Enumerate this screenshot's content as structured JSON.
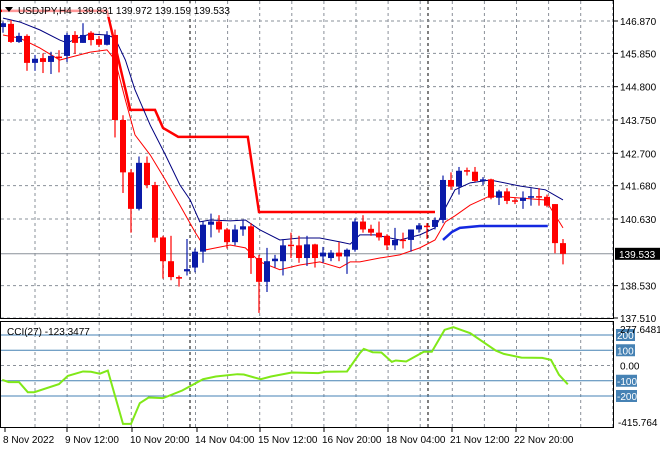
{
  "header": {
    "symbol": "USDJPY,H4",
    "ohlc": "139.831 139.972 139.159 139.533"
  },
  "indicator": {
    "label": "CCI(27) -123.3477"
  },
  "colors": {
    "bull": "#0a1aa8",
    "bear": "#ff0000",
    "upper_band": "#000080",
    "lower_band": "#ff0000",
    "step_red": "#ff0000",
    "step_blue": "#1428e0",
    "cci": "#80e818",
    "level": "#4682b4",
    "price_tag_bg": "#000000"
  },
  "price_axis": {
    "labels": [
      "146.870",
      "145.850",
      "144.800",
      "143.750",
      "142.700",
      "141.680",
      "140.630",
      "138.530",
      "137.510"
    ],
    "current_price": "139.533"
  },
  "cci_axis": {
    "max_label": "277.6481",
    "min_label": "-415.764",
    "zero_label": "0.00",
    "levels": [
      "200",
      "100",
      "-100",
      "-200"
    ]
  },
  "time_axis": {
    "labels": [
      "8 Nov 2022",
      "9 Nov 12:00",
      "10 Nov 20:00",
      "14 Nov 04:00",
      "15 Nov 12:00",
      "16 Nov 20:00",
      "18 Nov 04:00",
      "21 Nov 12:00",
      "22 Nov 20:00"
    ]
  },
  "chart_data": {
    "type": "candlestick",
    "title": "USDJPY,H4",
    "ylim": [
      137.51,
      146.87
    ],
    "candles_ohlc": [
      [
        146.68,
        146.85,
        146.5,
        146.8
      ],
      [
        146.78,
        146.9,
        146.18,
        146.21
      ],
      [
        146.21,
        146.5,
        146.18,
        146.4
      ],
      [
        146.4,
        146.45,
        145.3,
        145.55
      ],
      [
        145.55,
        145.8,
        145.3,
        145.68
      ],
      [
        145.7,
        145.85,
        145.23,
        145.58
      ],
      [
        145.58,
        145.9,
        145.2,
        145.77
      ],
      [
        145.75,
        145.95,
        145.25,
        145.7
      ],
      [
        145.77,
        146.5,
        145.58,
        146.43
      ],
      [
        146.43,
        146.55,
        145.83,
        146.18
      ],
      [
        146.18,
        146.8,
        146.18,
        146.43
      ],
      [
        146.5,
        146.55,
        146.1,
        146.27
      ],
      [
        146.3,
        146.4,
        146.05,
        146.12
      ],
      [
        146.12,
        146.55,
        146.1,
        146.43
      ],
      [
        146.43,
        146.6,
        143.2,
        143.75
      ],
      [
        143.75,
        143.9,
        141.45,
        142.1
      ],
      [
        142.1,
        142.2,
        140.2,
        140.95
      ],
      [
        140.95,
        142.6,
        140.9,
        142.4
      ],
      [
        142.4,
        142.6,
        141.6,
        141.7
      ],
      [
        141.7,
        141.8,
        139.9,
        140.04
      ],
      [
        140.05,
        140.1,
        138.75,
        139.3
      ],
      [
        139.3,
        140.1,
        138.7,
        138.8
      ],
      [
        138.8,
        138.85,
        138.5,
        138.75
      ],
      [
        138.98,
        140.0,
        138.85,
        139.05
      ],
      [
        139.1,
        139.7,
        138.95,
        139.6
      ],
      [
        139.6,
        140.55,
        139.25,
        140.45
      ],
      [
        140.45,
        140.8,
        140.05,
        140.55
      ],
      [
        140.55,
        140.75,
        140.2,
        140.3
      ],
      [
        140.3,
        140.35,
        139.7,
        139.9
      ],
      [
        139.9,
        140.45,
        139.8,
        140.3
      ],
      [
        140.3,
        140.6,
        140.1,
        140.4
      ],
      [
        140.4,
        140.5,
        138.9,
        139.4
      ],
      [
        139.4,
        139.5,
        137.67,
        138.65
      ],
      [
        138.65,
        139.72,
        138.33,
        139.3
      ],
      [
        139.3,
        139.5,
        139.1,
        139.38
      ],
      [
        139.3,
        140.0,
        138.85,
        139.8
      ],
      [
        139.82,
        140.2,
        139.4,
        139.78
      ],
      [
        139.8,
        140.1,
        139.25,
        139.4
      ],
      [
        139.4,
        140.1,
        139.15,
        139.83
      ],
      [
        139.83,
        139.85,
        139.1,
        139.4
      ],
      [
        139.45,
        139.75,
        139.25,
        139.57
      ],
      [
        139.4,
        139.65,
        139.3,
        139.57
      ],
      [
        139.57,
        139.9,
        139.3,
        139.45
      ],
      [
        139.45,
        139.7,
        138.9,
        139.66
      ],
      [
        139.66,
        140.65,
        139.6,
        140.55
      ],
      [
        140.55,
        140.75,
        140.2,
        140.3
      ],
      [
        140.32,
        140.45,
        140.1,
        140.2
      ],
      [
        140.2,
        140.55,
        139.95,
        140.05
      ],
      [
        140.1,
        140.15,
        139.65,
        139.8
      ],
      [
        139.8,
        140.35,
        139.65,
        139.97
      ],
      [
        139.98,
        140.2,
        139.7,
        139.95
      ],
      [
        139.97,
        140.3,
        139.6,
        140.3
      ],
      [
        140.3,
        140.5,
        140.2,
        140.43
      ],
      [
        140.42,
        140.5,
        140.0,
        140.38
      ],
      [
        140.38,
        140.68,
        140.3,
        140.6
      ],
      [
        140.6,
        142.0,
        140.5,
        141.86
      ],
      [
        141.86,
        142.1,
        141.55,
        141.65
      ],
      [
        141.65,
        142.27,
        141.4,
        142.15
      ],
      [
        142.17,
        142.25,
        142.0,
        142.12
      ],
      [
        142.12,
        142.27,
        141.8,
        141.83
      ],
      [
        141.83,
        141.95,
        141.7,
        141.88
      ],
      [
        141.88,
        141.9,
        141.25,
        141.3
      ],
      [
        141.3,
        141.55,
        141.07,
        141.5
      ],
      [
        141.5,
        141.6,
        141.1,
        141.2
      ],
      [
        141.22,
        141.3,
        141.1,
        141.18
      ],
      [
        141.2,
        141.5,
        140.95,
        141.3
      ],
      [
        141.3,
        141.6,
        141.05,
        141.35
      ],
      [
        141.35,
        141.6,
        141.05,
        141.32
      ],
      [
        141.33,
        141.4,
        141.0,
        141.05
      ],
      [
        141.1,
        141.1,
        139.55,
        139.87
      ],
      [
        139.87,
        140.0,
        139.2,
        139.533
      ]
    ],
    "upper_band": [
      [
        0,
        146.96
      ],
      [
        2.1,
        146.84
      ],
      [
        4.6,
        146.59
      ],
      [
        7.1,
        146.27
      ],
      [
        8,
        146.18
      ],
      [
        9.6,
        146.36
      ],
      [
        10.9,
        146.46
      ],
      [
        13,
        146.43
      ],
      [
        14,
        146.33
      ],
      [
        15.3,
        145.64
      ],
      [
        16.5,
        144.7
      ],
      [
        18.4,
        143.59
      ],
      [
        20.3,
        142.65
      ],
      [
        22.1,
        141.71
      ],
      [
        23.4,
        141.23
      ],
      [
        24.6,
        140.54
      ],
      [
        25.9,
        140.6
      ],
      [
        28.4,
        140.57
      ],
      [
        30.3,
        140.6
      ],
      [
        32.1,
        140.29
      ],
      [
        34.6,
        139.97
      ],
      [
        37.1,
        140.03
      ],
      [
        39.6,
        140.03
      ],
      [
        42.1,
        139.91
      ],
      [
        43.4,
        139.84
      ],
      [
        44.6,
        140.13
      ],
      [
        46.5,
        140.13
      ],
      [
        49.6,
        139.97
      ],
      [
        52.1,
        140.13
      ],
      [
        54,
        140.35
      ],
      [
        55.3,
        140.98
      ],
      [
        56.5,
        141.55
      ],
      [
        58.4,
        141.77
      ],
      [
        60.9,
        141.86
      ],
      [
        64.6,
        141.67
      ],
      [
        67.8,
        141.55
      ],
      [
        70,
        141.23
      ]
    ],
    "lower_band": [
      [
        0,
        146.43
      ],
      [
        2.1,
        146.33
      ],
      [
        4.6,
        146.02
      ],
      [
        7.1,
        145.64
      ],
      [
        8,
        145.7
      ],
      [
        10.9,
        145.89
      ],
      [
        13,
        145.96
      ],
      [
        14,
        145.64
      ],
      [
        15.3,
        144.38
      ],
      [
        16.5,
        143.28
      ],
      [
        18.4,
        142.65
      ],
      [
        20.3,
        141.86
      ],
      [
        22.1,
        141.07
      ],
      [
        24,
        140.22
      ],
      [
        25.4,
        139.66
      ],
      [
        26.6,
        139.72
      ],
      [
        28.4,
        139.81
      ],
      [
        30.3,
        139.72
      ],
      [
        32.1,
        139.28
      ],
      [
        34.6,
        139.03
      ],
      [
        37.1,
        139.18
      ],
      [
        39.6,
        139.28
      ],
      [
        42.1,
        139.09
      ],
      [
        43.4,
        139.28
      ],
      [
        44.6,
        139.28
      ],
      [
        47.1,
        139.4
      ],
      [
        49.6,
        139.5
      ],
      [
        52.1,
        139.72
      ],
      [
        54,
        139.97
      ],
      [
        55.3,
        140.54
      ],
      [
        56.5,
        140.73
      ],
      [
        58.4,
        141.07
      ],
      [
        60.9,
        141.36
      ],
      [
        64.6,
        141.29
      ],
      [
        67.8,
        141.23
      ],
      [
        69,
        140.76
      ],
      [
        70,
        140.35
      ]
    ],
    "step_red": [
      [
        -0.5,
        147.19
      ],
      [
        13,
        147.19
      ],
      [
        15.9,
        144.07
      ],
      [
        19,
        144.07
      ],
      [
        20,
        143.5
      ],
      [
        21.9,
        143.22
      ],
      [
        30.6,
        143.22
      ],
      [
        32,
        140.85
      ],
      [
        54,
        140.85
      ]
    ],
    "step_blue": [
      [
        55,
        139.97
      ],
      [
        56.1,
        140.22
      ],
      [
        57.1,
        140.35
      ],
      [
        59.6,
        140.41
      ],
      [
        68.1,
        140.41
      ]
    ],
    "cci": {
      "name": "CCI(27)",
      "ylim": [
        -415.764,
        277.6481
      ],
      "levels": [
        200,
        100,
        0,
        -100,
        -200
      ],
      "points": [
        [
          -0.1,
          -94
        ],
        [
          0.7,
          -109
        ],
        [
          2,
          -109
        ],
        [
          3.1,
          -175
        ],
        [
          3.9,
          -175
        ],
        [
          7,
          -122
        ],
        [
          8.1,
          -68
        ],
        [
          10,
          -39
        ],
        [
          11,
          -41
        ],
        [
          12.1,
          -54
        ],
        [
          13.1,
          -33
        ],
        [
          15,
          -383
        ],
        [
          16,
          -383
        ],
        [
          17.1,
          -247
        ],
        [
          18.2,
          -210
        ],
        [
          20,
          -214
        ],
        [
          22.4,
          -164
        ],
        [
          25,
          -90
        ],
        [
          26.6,
          -72
        ],
        [
          29.3,
          -57
        ],
        [
          30.1,
          -59
        ],
        [
          32.2,
          -90
        ],
        [
          33.5,
          -72
        ],
        [
          36.1,
          -46
        ],
        [
          39.4,
          -50
        ],
        [
          40.4,
          -41
        ],
        [
          43,
          -39
        ],
        [
          44.6,
          81
        ],
        [
          45.1,
          109
        ],
        [
          46.2,
          87
        ],
        [
          47.3,
          85
        ],
        [
          48.6,
          24
        ],
        [
          49.1,
          33
        ],
        [
          50.4,
          26
        ],
        [
          52.6,
          90
        ],
        [
          53.6,
          90
        ],
        [
          55.2,
          234
        ],
        [
          56.3,
          251
        ],
        [
          58.4,
          212
        ],
        [
          61.6,
          98
        ],
        [
          62.6,
          76
        ],
        [
          64.8,
          52
        ],
        [
          67.4,
          50
        ],
        [
          68.5,
          37
        ],
        [
          69.5,
          -61
        ],
        [
          70.6,
          -123.35
        ]
      ]
    }
  }
}
